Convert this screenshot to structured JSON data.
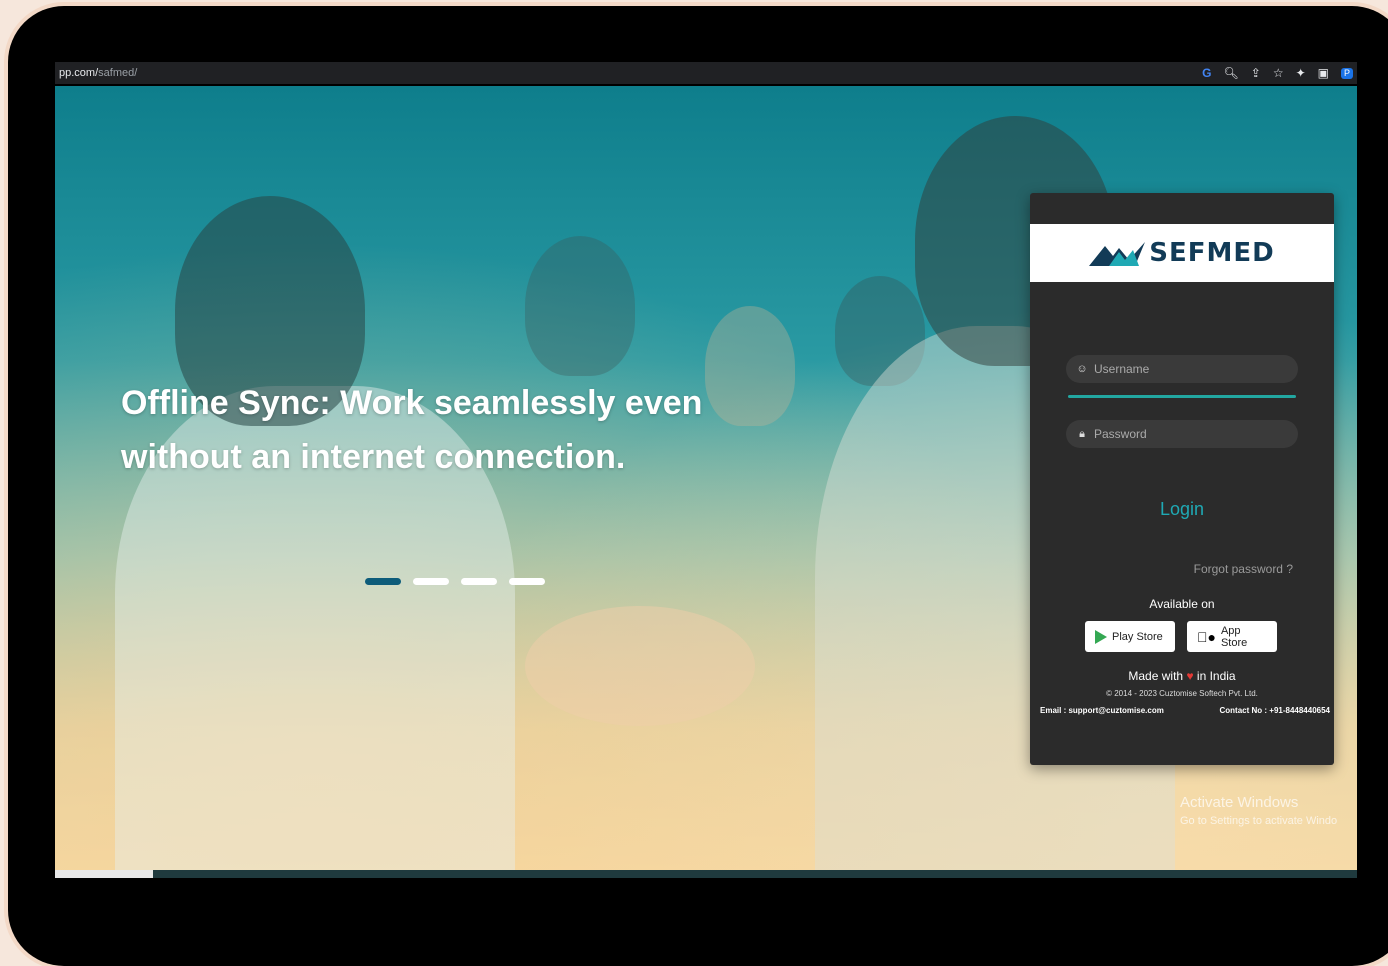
{
  "browser": {
    "url_prefix": "pp.com/",
    "url_path": "safmed/",
    "profile_initial": "P"
  },
  "slide": {
    "headline_line1": "Offline Sync: Work seamlessly even",
    "headline_line2": "without an internet connection.",
    "slide_count": 4,
    "active_slide": 1
  },
  "login": {
    "brand": "SEFMED",
    "username_placeholder": "Username",
    "password_placeholder": "Password",
    "login_label": "Login",
    "forgot_label": "Forgot password ?",
    "available_on": "Available on",
    "play_store": "Play Store",
    "app_store": "App Store",
    "made_with_prefix": "Made with",
    "made_with_suffix": "in India",
    "copyright": "© 2014 - 2023 Cuztomise Softech Pvt. Ltd.",
    "email": "Email : support@cuztomise.com",
    "contact": "Contact No : +91-8448440654"
  },
  "watermark": {
    "title": "Activate Windows",
    "subtitle": "Go to Settings to activate Windo"
  },
  "colors": {
    "accent": "#1fa9b4",
    "brand": "#123b57",
    "card_bg": "#2b2b2b",
    "active_dot": "#0d5c7a"
  }
}
